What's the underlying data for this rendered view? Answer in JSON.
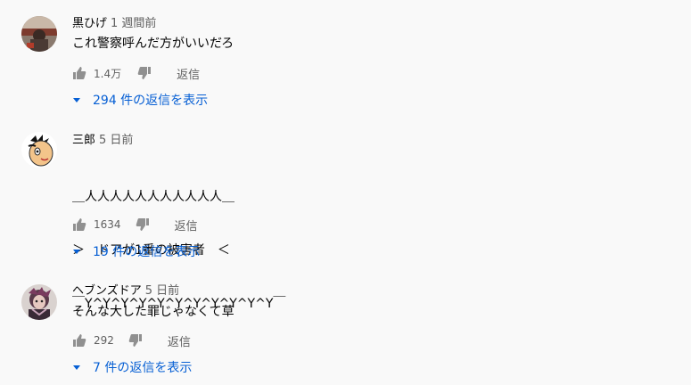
{
  "comments": [
    {
      "author": "黒ひげ",
      "time": "1 週間前",
      "lines": [
        "これ警察呼んだ方がいいだろ"
      ],
      "likes": "1.4万",
      "reply_label": "返信",
      "replies_label": "294 件の返信を表示"
    },
    {
      "author": "三郎",
      "time": "5 日前",
      "lines": [
        "＿人人人人人人人人人人人＿",
        "＞　ドアが1番の被害者　＜",
        "￣Y^Y^Y^Y^Y^Y^Y^Y^Y^Y^Y￣"
      ],
      "likes": "1634",
      "reply_label": "返信",
      "replies_label": "19 件の返信を表示"
    },
    {
      "author": "ヘブンズドア",
      "time": "5 日前",
      "lines": [
        "そんな大した罪じゃなくて草"
      ],
      "likes": "292",
      "reply_label": "返信",
      "replies_label": "7 件の返信を表示"
    }
  ],
  "icons": {
    "like": "thumbs-up-icon",
    "dislike": "thumbs-down-icon",
    "expand": "caret-down-icon"
  },
  "colors": {
    "background": "#f9f9f9",
    "link": "#065fd4",
    "secondary_text": "#606060"
  }
}
